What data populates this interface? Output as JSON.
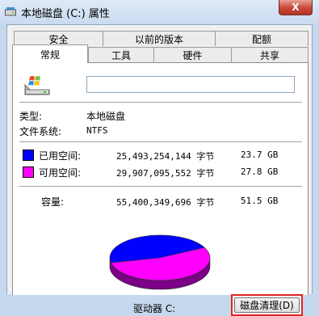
{
  "window": {
    "title": "本地磁盘 (C:) 属性",
    "close_label": "X"
  },
  "tabs": {
    "row1": [
      "安全",
      "以前的版本",
      "配额"
    ],
    "row2": [
      "常规",
      "工具",
      "硬件",
      "共享"
    ],
    "active": "常规"
  },
  "general": {
    "name_value": "",
    "type_label": "类型:",
    "type_value": "本地磁盘",
    "fs_label": "文件系统:",
    "fs_value": "NTFS",
    "used_label": "已用空间:",
    "used_bytes": "25,493,254,144 字节",
    "used_gb": "23.7 GB",
    "free_label": "可用空间:",
    "free_bytes": "29,907,095,552 字节",
    "free_gb": "27.8 GB",
    "capacity_label": "容量:",
    "capacity_bytes": "55,400,349,696 字节",
    "capacity_gb": "51.5 GB",
    "drive_label": "驱动器 C:",
    "cleanup_button": "磁盘清理(D)"
  },
  "colors": {
    "used": "#0000ff",
    "free": "#ff00ff",
    "highlight": "#e02424"
  },
  "chart_data": {
    "type": "pie",
    "title": "",
    "slices": [
      {
        "name": "已用空间",
        "value": 23.7
      },
      {
        "name": "可用空间",
        "value": 27.8
      }
    ]
  },
  "icons": {
    "app": "drive-icon",
    "drive": "drive-windows-icon"
  }
}
